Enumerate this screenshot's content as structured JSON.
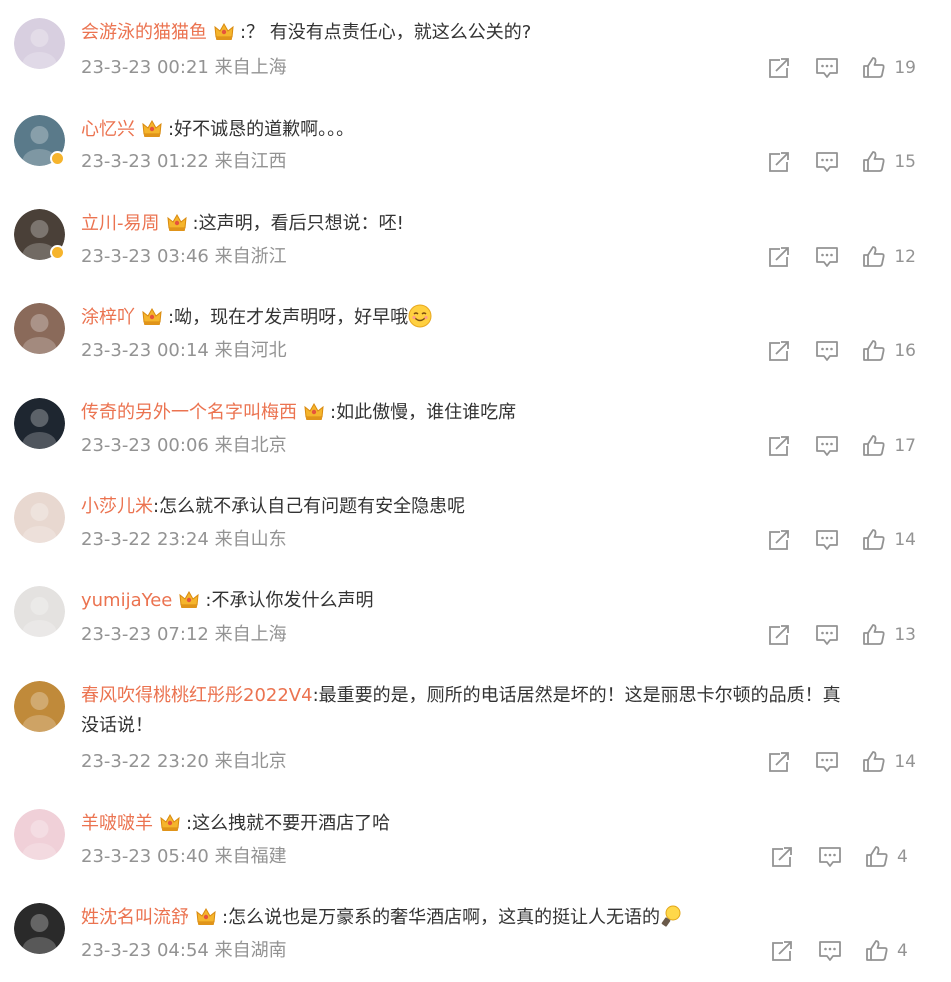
{
  "comments": [
    {
      "user": "会游泳的猫猫鱼",
      "text": ":？ 有没有点责任心，就这么公关的?",
      "text2": "",
      "time": "23-3-23 00:21",
      "location": "来自上海",
      "likes": "19",
      "badge": true,
      "verified": false,
      "avatar_color": "#d8cfe0"
    },
    {
      "user": "心忆兴",
      "text": ":好不诚恳的道歉啊。。。",
      "text2": "",
      "time": "23-3-23 01:22",
      "location": "来自江西",
      "likes": "15",
      "badge": true,
      "verified": true,
      "avatar_color": "#5a7a8a"
    },
    {
      "user": "立川-易周",
      "text": ":这声明，看后只想说：呸!",
      "text2": "",
      "time": "23-3-23 03:46",
      "location": "来自浙江",
      "likes": "12",
      "badge": true,
      "verified": true,
      "avatar_color": "#4a4038"
    },
    {
      "user": "涂梓吖",
      "text": ":呦，现在才发声明呀，好早哦",
      "text2": "",
      "time": "23-3-23 00:14",
      "location": "来自河北",
      "likes": "16",
      "badge": true,
      "verified": false,
      "avatar_color": "#8a6a5a",
      "emoji": "smile"
    },
    {
      "user": "传奇的另外一个名字叫梅西",
      "text": ":如此傲慢，谁住谁吃席",
      "text2": "",
      "time": "23-3-23 00:06",
      "location": "来自北京",
      "likes": "17",
      "badge": true,
      "verified": false,
      "avatar_color": "#1e2630"
    },
    {
      "user": "小莎儿米",
      "text": ":怎么就不承认自己有问题有安全隐患呢",
      "text2": "",
      "time": "23-3-22 23:24",
      "location": "来自山东",
      "likes": "14",
      "badge": false,
      "verified": false,
      "avatar_color": "#e8d8d0"
    },
    {
      "user": "yumijaYee",
      "text": ":不承认你发什么声明",
      "text2": "",
      "time": "23-3-23 07:12",
      "location": "来自上海",
      "likes": "13",
      "badge": true,
      "verified": false,
      "avatar_color": "#e4e2e0"
    },
    {
      "user": "春风吹得桃桃红彤彤2022V4",
      "text": ":最重要的是，厕所的电话居然是坏的！这是丽思卡尔顿的品质！真",
      "text2": "没话说！",
      "time": "23-3-22 23:20",
      "location": "来自北京",
      "likes": "14",
      "badge": false,
      "verified": false,
      "avatar_color": "#c08a3a"
    },
    {
      "user": "羊啵啵羊",
      "text": ":这么拽就不要开酒店了哈",
      "text2": "",
      "time": "23-3-23 05:40",
      "location": "来自福建",
      "likes": "4",
      "badge": true,
      "verified": false,
      "avatar_color": "#f0d0d8"
    },
    {
      "user": "姓沈名叫流舒",
      "text": ":怎么说也是万豪系的奢华酒店啊，这真的挺让人无语的",
      "text2": "",
      "time": "23-3-23 04:54",
      "location": "来自湖南",
      "likes": "4",
      "badge": true,
      "verified": false,
      "avatar_color": "#2a2a2a",
      "emoji": "lightbulb"
    }
  ],
  "colors": {
    "username": "#eb7350",
    "meta": "#939393",
    "text": "#333333",
    "icon": "#939393"
  },
  "icons": [
    "share-icon",
    "comment-icon",
    "like-icon",
    "crown-badge-icon",
    "verified-badge-icon"
  ]
}
